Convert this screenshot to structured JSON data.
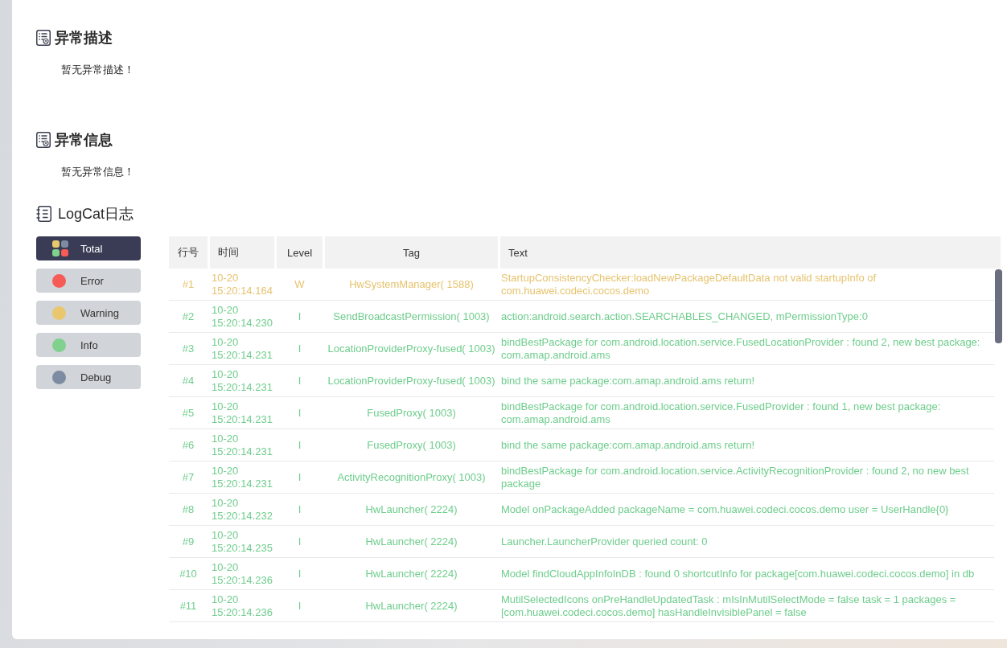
{
  "sections": [
    {
      "title": "异常描述",
      "message": "暂无异常描述！"
    },
    {
      "title": "异常信息",
      "message": "暂无异常信息！"
    }
  ],
  "logcat": {
    "title": "LogCat日志",
    "filters": [
      {
        "label": "Total",
        "kind": "all",
        "selected": true
      },
      {
        "label": "Error",
        "kind": "level",
        "color": "#f65b58",
        "selected": false
      },
      {
        "label": "Warning",
        "kind": "level",
        "color": "#e9c76f",
        "selected": false
      },
      {
        "label": "Info",
        "kind": "level",
        "color": "#80d18d",
        "selected": false
      },
      {
        "label": "Debug",
        "kind": "level",
        "color": "#7d8ca3",
        "selected": false
      }
    ],
    "table": {
      "columns": [
        "行号",
        "时间",
        "Level",
        "Tag",
        "Text"
      ],
      "rows": [
        {
          "number": "#1",
          "time": "10-20 15:20:14.164",
          "level": "W",
          "tag": "HwSystemManager( 1588)",
          "text": "StartupConsistencyChecker:loadNewPackageDefaultData not valid startupInfo of com.huawei.codeci.cocos.demo",
          "color": "#e6c36e"
        },
        {
          "number": "#2",
          "time": "10-20 15:20:14.230",
          "level": "I",
          "tag": "SendBroadcastPermission( 1003)",
          "text": "action:android.search.action.SEARCHABLES_CHANGED, mPermissionType:0",
          "color": "#6ecd8c"
        },
        {
          "number": "#3",
          "time": "10-20 15:20:14.231",
          "level": "I",
          "tag": "LocationProviderProxy-fused( 1003)",
          "text": "bindBestPackage for com.android.location.service.FusedLocationProvider : found 2, new best package: com.amap.android.ams",
          "color": "#6ecd8c"
        },
        {
          "number": "#4",
          "time": "10-20 15:20:14.231",
          "level": "I",
          "tag": "LocationProviderProxy-fused( 1003)",
          "text": "bind the same package:com.amap.android.ams return!",
          "color": "#6ecd8c"
        },
        {
          "number": "#5",
          "time": "10-20 15:20:14.231",
          "level": "I",
          "tag": "FusedProxy( 1003)",
          "text": "bindBestPackage for com.android.location.service.FusedProvider : found 1, new best package: com.amap.android.ams",
          "color": "#6ecd8c"
        },
        {
          "number": "#6",
          "time": "10-20 15:20:14.231",
          "level": "I",
          "tag": "FusedProxy( 1003)",
          "text": "bind the same package:com.amap.android.ams return!",
          "color": "#6ecd8c"
        },
        {
          "number": "#7",
          "time": "10-20 15:20:14.231",
          "level": "I",
          "tag": "ActivityRecognitionProxy( 1003)",
          "text": "bindBestPackage for com.android.location.service.ActivityRecognitionProvider : found 2, no new best package",
          "color": "#6ecd8c"
        },
        {
          "number": "#8",
          "time": "10-20 15:20:14.232",
          "level": "I",
          "tag": "HwLauncher( 2224)",
          "text": "Model onPackageAdded packageName = com.huawei.codeci.cocos.demo user = UserHandle{0}",
          "color": "#6ecd8c"
        },
        {
          "number": "#9",
          "time": "10-20 15:20:14.235",
          "level": "I",
          "tag": "HwLauncher( 2224)",
          "text": "Launcher.LauncherProvider queried count: 0",
          "color": "#6ecd8c"
        },
        {
          "number": "#10",
          "time": "10-20 15:20:14.236",
          "level": "I",
          "tag": "HwLauncher( 2224)",
          "text": "Model findCloudAppInfoInDB : found 0 shortcutInfo for package[com.huawei.codeci.cocos.demo] in db",
          "color": "#6ecd8c"
        },
        {
          "number": "#11",
          "time": "10-20 15:20:14.236",
          "level": "I",
          "tag": "HwLauncher( 2224)",
          "text": "MutilSelectedIcons onPreHandleUpdatedTask : mIsInMutilSelectMode = false task = 1 packages = [com.huawei.codeci.cocos.demo] hasHandleInvisiblePanel = false",
          "color": "#6ecd8c"
        }
      ]
    }
  }
}
